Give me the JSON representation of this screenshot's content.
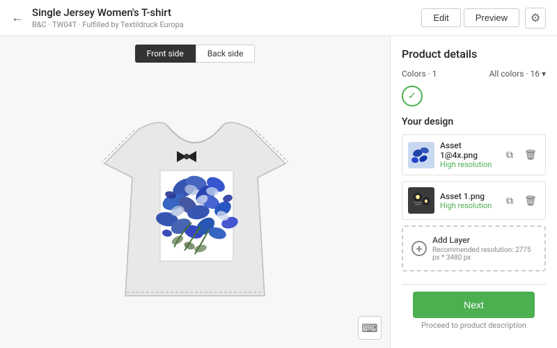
{
  "header": {
    "back_icon": "←",
    "title": "Single Jersey Women's T-shirt",
    "subtitle": "B&C · TW04T · Fulfilled by Textildruck Europa",
    "edit_label": "Edit",
    "preview_label": "Preview",
    "gear_icon": "⚙"
  },
  "left_panel": {
    "front_side_label": "Front side",
    "back_side_label": "Back side",
    "keyboard_icon": "⌨"
  },
  "right_panel": {
    "product_details_title": "Product details",
    "colors_label": "Colors · 1",
    "all_colors_label": "All colors · 16",
    "check_icon": "✓",
    "chevron_icon": "▾",
    "your_design_title": "Your design",
    "design_items": [
      {
        "name": "Asset 1@4x.png",
        "resolution": "High resolution",
        "thumb_color": "#c8d8e8"
      },
      {
        "name": "Asset 1.png",
        "resolution": "High resolution",
        "thumb_color": "#3a3a3a"
      }
    ],
    "add_layer_label": "Add Layer",
    "add_layer_sub": "Recommended resolution: 2775 px * 3480 px",
    "copy_icon": "⧉",
    "delete_icon": "🗑"
  },
  "bottom_bar": {
    "next_label": "Next",
    "hint_label": "Proceed to product description"
  }
}
